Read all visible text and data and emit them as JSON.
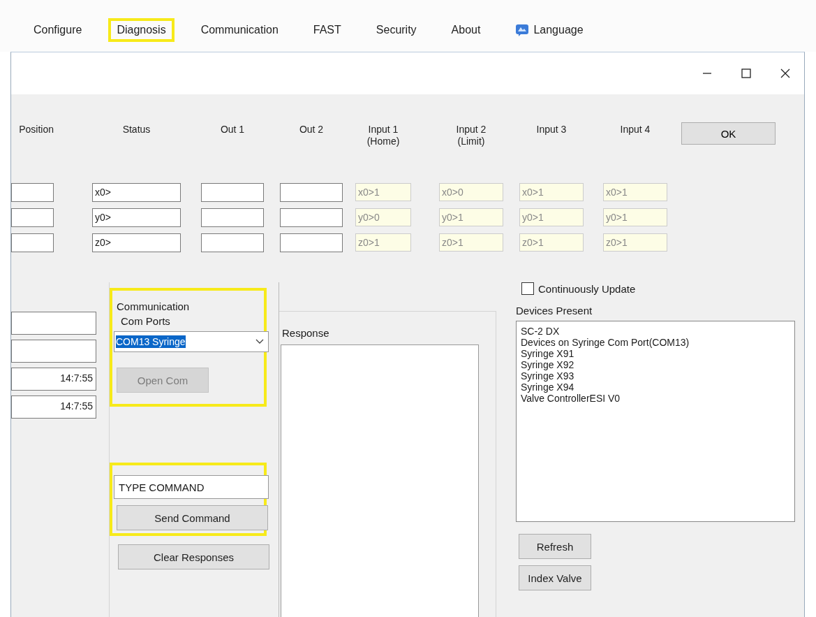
{
  "menu": [
    {
      "label": "Configure",
      "highlighted": false
    },
    {
      "label": "Diagnosis",
      "highlighted": true
    },
    {
      "label": "Communication",
      "highlighted": false
    },
    {
      "label": "FAST",
      "highlighted": false
    },
    {
      "label": "Security",
      "highlighted": false
    },
    {
      "label": "About",
      "highlighted": false
    },
    {
      "label": "Language",
      "highlighted": false,
      "kind": "icon"
    }
  ],
  "columns": [
    {
      "lines": [
        "Position"
      ]
    },
    {
      "lines": [
        "Status"
      ]
    },
    {
      "lines": [
        "Out 1"
      ]
    },
    {
      "lines": [
        "Out 2"
      ]
    },
    {
      "lines": [
        "Input 1",
        "(Home)"
      ]
    },
    {
      "lines": [
        "Input 2",
        "(Limit)"
      ]
    },
    {
      "lines": [
        "Input 3"
      ]
    },
    {
      "lines": [
        "Input 4"
      ]
    }
  ],
  "ok_button": "OK",
  "rows": [
    {
      "status": "x0>",
      "inputs": [
        "x0>1",
        "x0>0",
        "x0>1",
        "x0>1"
      ]
    },
    {
      "status": "y0>",
      "inputs": [
        "y0>0",
        "y0>1",
        "y0>1",
        "y0>1"
      ]
    },
    {
      "status": "z0>",
      "inputs": [
        "z0>1",
        "z0>1",
        "z0>1",
        "z0>1"
      ]
    }
  ],
  "left_fields": [
    {
      "kind": "empty"
    },
    {
      "kind": "empty"
    },
    {
      "kind": "time",
      "value": "14:7:55"
    },
    {
      "kind": "time",
      "value": "14:7:55"
    }
  ],
  "communication": {
    "highlighted": true,
    "title": "Communication",
    "com_ports_label": "Com Ports",
    "com_port": "COM13 Syringe",
    "open_button": {
      "label": "Open Com",
      "disabled": true
    }
  },
  "command": {
    "highlighted": true,
    "value": "TYPE COMMAND",
    "send_button": "Send Command"
  },
  "clear_button": "Clear Responses",
  "response": {
    "label": "Response"
  },
  "continuous_update": {
    "label": "Continuously Update",
    "checked": false
  },
  "devices": {
    "label": "Devices Present",
    "items": [
      "SC-2 DX",
      "Devices on Syringe Com Port(COM13)",
      "Syringe X91",
      "Syringe X92",
      "Syringe X93",
      "Syringe X94",
      "Valve ControllerESI V0"
    ]
  },
  "refresh_button": "Refresh",
  "index_valve_button": "Index Valve"
}
